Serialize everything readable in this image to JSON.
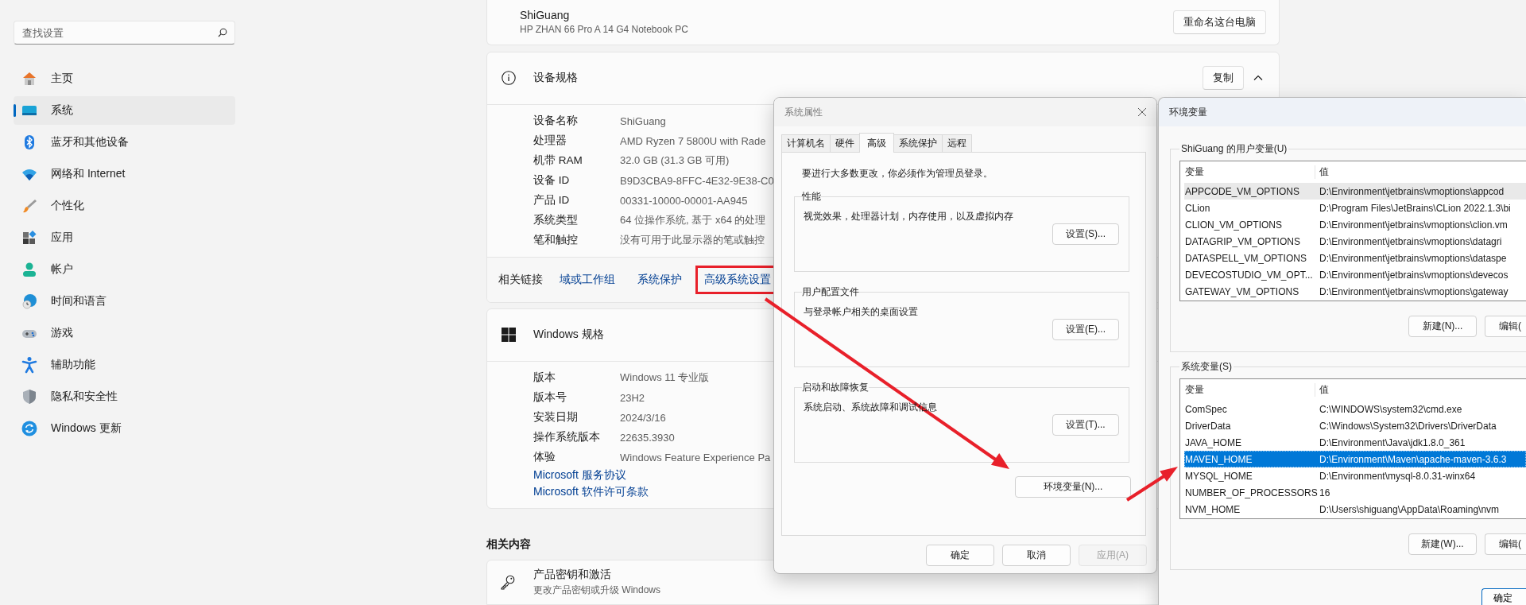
{
  "sidebar": {
    "search": {
      "placeholder": "查找设置"
    },
    "items": [
      {
        "label": "主页",
        "selected": false
      },
      {
        "label": "系统",
        "selected": true
      },
      {
        "label": "蓝牙和其他设备",
        "selected": false
      },
      {
        "label": "网络和 Internet",
        "selected": false
      },
      {
        "label": "个性化",
        "selected": false
      },
      {
        "label": "应用",
        "selected": false
      },
      {
        "label": "帐户",
        "selected": false
      },
      {
        "label": "时间和语言",
        "selected": false
      },
      {
        "label": "游戏",
        "selected": false
      },
      {
        "label": "辅助功能",
        "selected": false
      },
      {
        "label": "隐私和安全性",
        "selected": false
      },
      {
        "label": "Windows 更新",
        "selected": false
      }
    ]
  },
  "device_card": {
    "name": "ShiGuang",
    "model": "HP ZHAN 66 Pro A 14 G4 Notebook PC",
    "rename_button": "重命名这台电脑"
  },
  "device_specs": {
    "title": "设备规格",
    "copy_button": "复制",
    "expanded": true,
    "rows": [
      {
        "label": "设备名称",
        "value": "ShiGuang"
      },
      {
        "label": "处理器",
        "value": "AMD Ryzen 7 5800U with Rade"
      },
      {
        "label": "机带 RAM",
        "value": "32.0 GB (31.3 GB 可用)"
      },
      {
        "label": "设备 ID",
        "value": "B9D3CBA9-8FFC-4E32-9E38-C0"
      },
      {
        "label": "产品 ID",
        "value": "00331-10000-00001-AA945"
      },
      {
        "label": "系统类型",
        "value": "64 位操作系统, 基于 x64 的处理"
      },
      {
        "label": "笔和触控",
        "value": "没有可用于此显示器的笔或触控"
      }
    ]
  },
  "related_links": {
    "label": "相关链接",
    "links": [
      {
        "label": "域或工作组",
        "highlighted": false
      },
      {
        "label": "系统保护",
        "highlighted": false
      },
      {
        "label": "高级系统设置",
        "highlighted": true
      }
    ]
  },
  "windows_specs": {
    "title": "Windows 规格",
    "rows": [
      {
        "label": "版本",
        "value": "Windows 11 专业版"
      },
      {
        "label": "版本号",
        "value": "23H2"
      },
      {
        "label": "安装日期",
        "value": "2024/3/16"
      },
      {
        "label": "操作系统版本",
        "value": "22635.3930"
      },
      {
        "label": "体验",
        "value": "Windows Feature Experience Pa"
      }
    ],
    "links": [
      "Microsoft 服务协议",
      "Microsoft 软件许可条款"
    ]
  },
  "related_content": {
    "heading": "相关内容",
    "items": [
      {
        "title": "产品密钥和激活",
        "subtitle": "更改产品密钥或升级 Windows"
      }
    ]
  },
  "system_properties": {
    "title": "系统属性",
    "tabs": [
      {
        "label": "计算机名",
        "selected": false
      },
      {
        "label": "硬件",
        "selected": false
      },
      {
        "label": "高级",
        "selected": true
      },
      {
        "label": "系统保护",
        "selected": false
      },
      {
        "label": "远程",
        "selected": false
      }
    ],
    "note": "要进行大多数更改，你必须作为管理员登录。",
    "groups": [
      {
        "title": "性能",
        "description": "视觉效果，处理器计划，内存使用，以及虚拟内存",
        "button": "设置(S)..."
      },
      {
        "title": "用户配置文件",
        "description": "与登录帐户相关的桌面设置",
        "button": "设置(E)..."
      },
      {
        "title": "启动和故障恢复",
        "description": "系统启动、系统故障和调试信息",
        "button": "设置(T)..."
      }
    ],
    "env_button": "环境变量(N)...",
    "buttons": [
      {
        "label": "确定",
        "disabled": false
      },
      {
        "label": "取消",
        "disabled": false
      },
      {
        "label": "应用(A)",
        "disabled": true
      }
    ]
  },
  "environment_variables": {
    "title": "环境变量",
    "user_vars": {
      "title": "ShiGuang 的用户变量(U)",
      "focused": false,
      "columns": [
        "变量",
        "值"
      ],
      "rows": [
        {
          "name": "APPCODE_VM_OPTIONS",
          "value": "D:\\Environment\\jetbrains\\vmoptions\\appcod",
          "selected": true
        },
        {
          "name": "CLion",
          "value": "D:\\Program Files\\JetBrains\\CLion 2022.1.3\\bi",
          "selected": false
        },
        {
          "name": "CLION_VM_OPTIONS",
          "value": "D:\\Environment\\jetbrains\\vmoptions\\clion.vm",
          "selected": false
        },
        {
          "name": "DATAGRIP_VM_OPTIONS",
          "value": "D:\\Environment\\jetbrains\\vmoptions\\datagri",
          "selected": false
        },
        {
          "name": "DATASPELL_VM_OPTIONS",
          "value": "D:\\Environment\\jetbrains\\vmoptions\\dataspe",
          "selected": false
        },
        {
          "name": "DEVECOSTUDIO_VM_OPT...",
          "value": "D:\\Environment\\jetbrains\\vmoptions\\devecos",
          "selected": false
        },
        {
          "name": "GATEWAY_VM_OPTIONS",
          "value": "D:\\Environment\\jetbrains\\vmoptions\\gateway",
          "selected": false
        }
      ],
      "buttons": [
        "新建(N)...",
        "编辑("
      ]
    },
    "system_vars": {
      "title": "系统变量(S)",
      "focused": true,
      "columns": [
        "变量",
        "值"
      ],
      "rows": [
        {
          "name": "ComSpec",
          "value": "C:\\WINDOWS\\system32\\cmd.exe",
          "selected": false
        },
        {
          "name": "DriverData",
          "value": "C:\\Windows\\System32\\Drivers\\DriverData",
          "selected": false
        },
        {
          "name": "JAVA_HOME",
          "value": "D:\\Environment\\Java\\jdk1.8.0_361",
          "selected": false
        },
        {
          "name": "MAVEN_HOME",
          "value": "D:\\Environment\\Maven\\apache-maven-3.6.3",
          "selected": true
        },
        {
          "name": "MYSQL_HOME",
          "value": "D:\\Environment\\mysql-8.0.31-winx64",
          "selected": false
        },
        {
          "name": "NUMBER_OF_PROCESSORS",
          "value": "16",
          "selected": false
        },
        {
          "name": "NVM_HOME",
          "value": "D:\\Users\\shiguang\\AppData\\Roaming\\nvm",
          "selected": false
        }
      ],
      "buttons": [
        "新建(W)...",
        "编辑("
      ]
    },
    "buttons": [
      "确定"
    ]
  }
}
